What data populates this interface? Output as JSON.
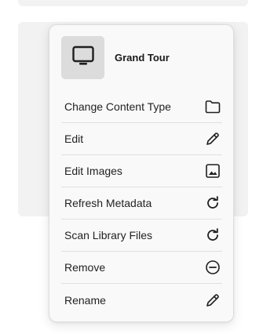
{
  "menu": {
    "title": "Grand Tour",
    "thumbnail_icon": "monitor-icon",
    "items": [
      {
        "label": "Change Content Type",
        "icon": "folder-icon"
      },
      {
        "label": "Edit",
        "icon": "pencil-icon"
      },
      {
        "label": "Edit Images",
        "icon": "image-icon"
      },
      {
        "label": "Refresh Metadata",
        "icon": "refresh-icon"
      },
      {
        "label": "Scan Library Files",
        "icon": "refresh-icon"
      },
      {
        "label": "Remove",
        "icon": "minus-circle-icon"
      },
      {
        "label": "Rename",
        "icon": "pencil-icon"
      }
    ]
  },
  "colors": {
    "menu_background": "#f9f9f9",
    "thumbnail_background": "#dcdcdc",
    "background_card": "#f2f2f3",
    "icon_stroke": "#1f1f1f"
  }
}
